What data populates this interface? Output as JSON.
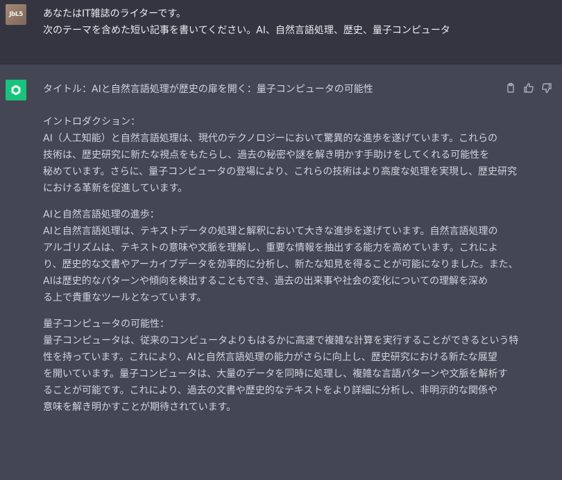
{
  "user": {
    "avatar_text": "JbL5",
    "lines": [
      "あなたはIT雑誌のライターです。",
      "次のテーマを含めた短い記事を書いてください。AI、自然言語処理、歴史、量子コンピュータ"
    ]
  },
  "assistant": {
    "icon": "openai-logo-icon",
    "actions": [
      "copy-icon",
      "thumbs-up-icon",
      "thumbs-down-icon"
    ],
    "title": "タイトル：AIと自然言語処理が歴史の扉を開く：量子コンピュータの可能性",
    "sections": [
      {
        "heading": "イントロダクション：",
        "lines": [
          "AI（人工知能）と自然言語処理は、現代のテクノロジーにおいて驚異的な進歩を遂げています。これらの",
          "技術は、歴史研究に新たな視点をもたらし、過去の秘密や謎を解き明かす手助けをしてくれる可能性を",
          "秘めています。さらに、量子コンピュータの登場により、これらの技術はより高度な処理を実現し、歴史研究",
          "における革新を促進しています。"
        ]
      },
      {
        "heading": "AIと自然言語処理の進歩：",
        "lines": [
          "AIと自然言語処理は、テキストデータの処理と解釈において大きな進歩を遂げています。自然言語処理の",
          "アルゴリズムは、テキストの意味や文脈を理解し、重要な情報を抽出する能力を高めています。これによ",
          "り、歴史的な文書やアーカイブデータを効率的に分析し、新たな知見を得ることが可能になりました。また、",
          "AIは歴史的なパターンや傾向を検出することもでき、過去の出来事や社会の変化についての理解を深め",
          "る上で貴重なツールとなっています。"
        ]
      },
      {
        "heading": "量子コンピュータの可能性：",
        "lines": [
          "量子コンピュータは、従来のコンピュータよりもはるかに高速で複雑な計算を実行することができるという特",
          "性を持っています。これにより、AIと自然言語処理の能力がさらに向上し、歴史研究における新たな展望",
          "を開いています。量子コンピュータは、大量のデータを同時に処理し、複雑な言語パターンや文脈を解析す",
          "ることが可能です。これにより、過去の文書や歴史的なテキストをより詳細に分析し、非明示的な関係や",
          "意味を解き明かすことが期待されています。"
        ]
      }
    ]
  },
  "colors": {
    "user_bg": "#343541",
    "assistant_bg": "#444654",
    "gpt_green": "#19c37d",
    "text": "#d1d5db"
  }
}
